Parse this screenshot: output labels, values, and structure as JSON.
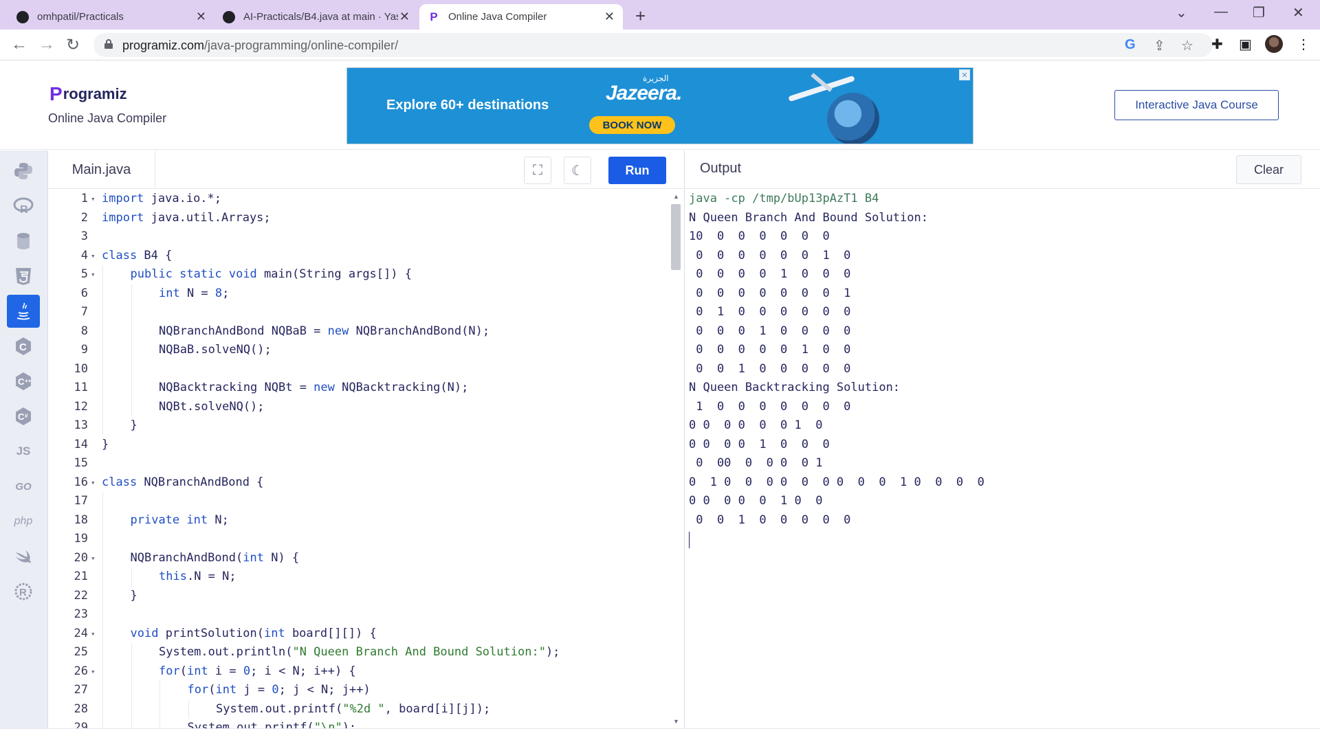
{
  "browser": {
    "tabs": [
      {
        "title": "omhpatil/Practicals",
        "favicon": "github-icon",
        "active": false
      },
      {
        "title": "AI-Practicals/B4.java at main · Yas",
        "favicon": "github-icon",
        "active": false
      },
      {
        "title": "Online Java Compiler",
        "favicon": "programiz-icon",
        "active": true
      }
    ],
    "new_tab": "+",
    "url_host": "programiz.com",
    "url_path": "/java-programming/online-compiler/",
    "window_controls": [
      "⌄",
      "—",
      "❐",
      "✕"
    ]
  },
  "header": {
    "logo_mark": "P",
    "logo_text": "rogramiz",
    "subtitle": "Online Java Compiler",
    "ad": {
      "cta": "Explore 60+ destinations",
      "brand": "Jazeera.",
      "brand_arabic": "الجزيرة",
      "button": "BOOK NOW"
    },
    "course_button": "Interactive Java Course"
  },
  "languages": [
    "python-icon",
    "r-icon",
    "sql-icon",
    "html5-icon",
    "java-icon",
    "c-icon",
    "cpp-icon",
    "csharp-icon",
    "js-icon",
    "go-icon",
    "php-icon",
    "swift-icon",
    "rust-icon"
  ],
  "lang_labels": {
    "js": "JS",
    "go": "GO",
    "php": "php"
  },
  "editor": {
    "file_name": "Main.java",
    "run_label": "Run",
    "lines": [
      {
        "n": "1",
        "fold": true,
        "indent": 0,
        "tokens": [
          [
            "kw",
            "import"
          ],
          [
            "t",
            " java.io.*;"
          ]
        ]
      },
      {
        "n": "2",
        "fold": false,
        "indent": 0,
        "tokens": [
          [
            "kw",
            "import"
          ],
          [
            "t",
            " java.util.Arrays;"
          ]
        ]
      },
      {
        "n": "3",
        "fold": false,
        "indent": 0,
        "tokens": []
      },
      {
        "n": "4",
        "fold": true,
        "indent": 0,
        "tokens": [
          [
            "kw",
            "class"
          ],
          [
            "t",
            " B4 {"
          ]
        ]
      },
      {
        "n": "5",
        "fold": true,
        "indent": 1,
        "tokens": [
          [
            "kw",
            "public"
          ],
          [
            "t",
            " "
          ],
          [
            "kw",
            "static"
          ],
          [
            "t",
            " "
          ],
          [
            "kw",
            "void"
          ],
          [
            "t",
            " main(String args[]) {"
          ]
        ]
      },
      {
        "n": "6",
        "fold": false,
        "indent": 2,
        "tokens": [
          [
            "kw",
            "int"
          ],
          [
            "t",
            " N = "
          ],
          [
            "num",
            "8"
          ],
          [
            "t",
            ";"
          ]
        ]
      },
      {
        "n": "7",
        "fold": false,
        "indent": 2,
        "tokens": []
      },
      {
        "n": "8",
        "fold": false,
        "indent": 2,
        "tokens": [
          [
            "t",
            "NQBranchAndBond NQBaB = "
          ],
          [
            "kw",
            "new"
          ],
          [
            "t",
            " NQBranchAndBond(N);"
          ]
        ]
      },
      {
        "n": "9",
        "fold": false,
        "indent": 2,
        "tokens": [
          [
            "t",
            "NQBaB.solveNQ();"
          ]
        ]
      },
      {
        "n": "10",
        "fold": false,
        "indent": 2,
        "tokens": []
      },
      {
        "n": "11",
        "fold": false,
        "indent": 2,
        "tokens": [
          [
            "t",
            "NQBacktracking NQBt = "
          ],
          [
            "kw",
            "new"
          ],
          [
            "t",
            " NQBacktracking(N);"
          ]
        ]
      },
      {
        "n": "12",
        "fold": false,
        "indent": 2,
        "tokens": [
          [
            "t",
            "NQBt.solveNQ();"
          ]
        ]
      },
      {
        "n": "13",
        "fold": false,
        "indent": 1,
        "tokens": [
          [
            "t",
            "}"
          ]
        ]
      },
      {
        "n": "14",
        "fold": false,
        "indent": 0,
        "tokens": [
          [
            "t",
            "}"
          ]
        ]
      },
      {
        "n": "15",
        "fold": false,
        "indent": 0,
        "tokens": []
      },
      {
        "n": "16",
        "fold": true,
        "indent": 0,
        "tokens": [
          [
            "kw",
            "class"
          ],
          [
            "t",
            " NQBranchAndBond {"
          ]
        ]
      },
      {
        "n": "17",
        "fold": false,
        "indent": 1,
        "tokens": []
      },
      {
        "n": "18",
        "fold": false,
        "indent": 1,
        "tokens": [
          [
            "kw",
            "private"
          ],
          [
            "t",
            " "
          ],
          [
            "kw",
            "int"
          ],
          [
            "t",
            " N;"
          ]
        ]
      },
      {
        "n": "19",
        "fold": false,
        "indent": 1,
        "tokens": []
      },
      {
        "n": "20",
        "fold": true,
        "indent": 1,
        "tokens": [
          [
            "t",
            "NQBranchAndBond("
          ],
          [
            "kw",
            "int"
          ],
          [
            "t",
            " N) {"
          ]
        ]
      },
      {
        "n": "21",
        "fold": false,
        "indent": 2,
        "tokens": [
          [
            "kw",
            "this"
          ],
          [
            "t",
            ".N = N;"
          ]
        ]
      },
      {
        "n": "22",
        "fold": false,
        "indent": 1,
        "tokens": [
          [
            "t",
            "}"
          ]
        ]
      },
      {
        "n": "23",
        "fold": false,
        "indent": 1,
        "tokens": []
      },
      {
        "n": "24",
        "fold": true,
        "indent": 1,
        "tokens": [
          [
            "kw",
            "void"
          ],
          [
            "t",
            " printSolution("
          ],
          [
            "kw",
            "int"
          ],
          [
            "t",
            " board[][]) {"
          ]
        ]
      },
      {
        "n": "25",
        "fold": false,
        "indent": 2,
        "tokens": [
          [
            "t",
            "System.out.println("
          ],
          [
            "str",
            "\"N Queen Branch And Bound Solution:\""
          ],
          [
            "t",
            ");"
          ]
        ]
      },
      {
        "n": "26",
        "fold": true,
        "indent": 2,
        "tokens": [
          [
            "kw",
            "for"
          ],
          [
            "t",
            "("
          ],
          [
            "kw",
            "int"
          ],
          [
            "t",
            " i = "
          ],
          [
            "num",
            "0"
          ],
          [
            "t",
            "; i < N; i++) {"
          ]
        ]
      },
      {
        "n": "27",
        "fold": false,
        "indent": 3,
        "tokens": [
          [
            "kw",
            "for"
          ],
          [
            "t",
            "("
          ],
          [
            "kw",
            "int"
          ],
          [
            "t",
            " j = "
          ],
          [
            "num",
            "0"
          ],
          [
            "t",
            "; j < N; j++)"
          ]
        ]
      },
      {
        "n": "28",
        "fold": false,
        "indent": 4,
        "tokens": [
          [
            "t",
            "System.out.printf("
          ],
          [
            "str",
            "\"%2d \""
          ],
          [
            "t",
            ", board[i][j]);"
          ]
        ]
      },
      {
        "n": "29",
        "fold": false,
        "indent": 3,
        "tokens": [
          [
            "t",
            "System.out.printf("
          ],
          [
            "str",
            "\"\\n\""
          ],
          [
            "t",
            ");"
          ]
        ]
      }
    ]
  },
  "output": {
    "title": "Output",
    "clear_label": "Clear",
    "command": "java -cp /tmp/bUp13pAzT1 B4",
    "lines": [
      "N Queen Branch And Bound Solution:",
      "10  0  0  0  0  0  0",
      " 0  0  0  0  0  0  1  0",
      " 0  0  0  0  1  0  0  0",
      " 0  0  0  0  0  0  0  1",
      " 0  1  0  0  0  0  0  0",
      " 0  0  0  1  0  0  0  0",
      " 0  0  0  0  0  1  0  0",
      " 0  0  1  0  0  0  0  0",
      "N Queen Backtracking Solution:",
      " 1  0  0  0  0  0  0  0",
      "0 0  0 0  0  0 1  0",
      "0 0  0 0  1  0  0  0",
      " 0  00  0  0 0  0 1",
      "0  1 0  0  0 0  0  0 0  0  0  1 0  0  0  0",
      "0 0  0 0  0  1 0  0",
      " 0  0  1  0  0  0  0  0"
    ]
  }
}
